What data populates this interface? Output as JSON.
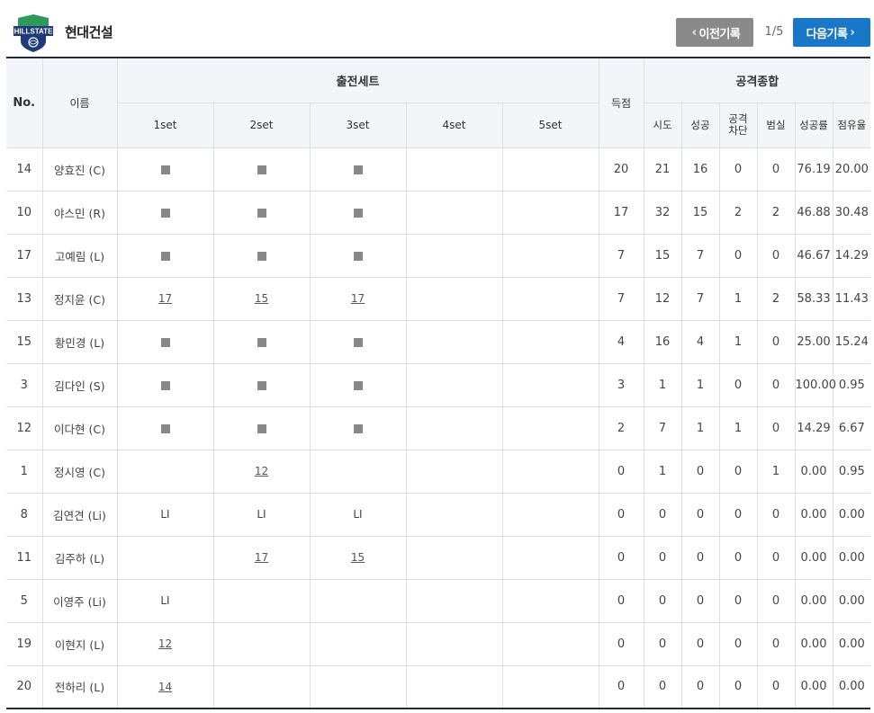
{
  "team": {
    "logo_text": "HILLSTATE",
    "name": "현대건설"
  },
  "nav": {
    "prev_label": "이전기록",
    "next_label": "다음기록",
    "page_indicator": "1/5"
  },
  "table": {
    "headers": {
      "no": "No.",
      "name": "이름",
      "sets_group": "출전세트",
      "sets": [
        "1set",
        "2set",
        "3set",
        "4set",
        "5set"
      ],
      "points": "득점",
      "attack_group": "공격종합",
      "attack": [
        "시도",
        "성공",
        "공격\n차단",
        "범실",
        "성공률",
        "점유율"
      ]
    },
    "rows": [
      {
        "no": "14",
        "name": "양효진 (C)",
        "sets": [
          "sq",
          "sq",
          "sq",
          "",
          ""
        ],
        "points": "20",
        "attempt": "21",
        "success": "16",
        "blocked": "0",
        "error": "0",
        "rate": "76.19",
        "share": "20.00"
      },
      {
        "no": "10",
        "name": "야스민 (R)",
        "sets": [
          "sq",
          "sq",
          "sq",
          "",
          ""
        ],
        "points": "17",
        "attempt": "32",
        "success": "15",
        "blocked": "2",
        "error": "2",
        "rate": "46.88",
        "share": "30.48"
      },
      {
        "no": "17",
        "name": "고예림 (L)",
        "sets": [
          "sq",
          "sq",
          "sq",
          "",
          ""
        ],
        "points": "7",
        "attempt": "15",
        "success": "7",
        "blocked": "0",
        "error": "0",
        "rate": "46.67",
        "share": "14.29"
      },
      {
        "no": "13",
        "name": "정지윤 (C)",
        "sets": [
          "17",
          "15",
          "17",
          "",
          ""
        ],
        "points": "7",
        "attempt": "12",
        "success": "7",
        "blocked": "1",
        "error": "2",
        "rate": "58.33",
        "share": "11.43"
      },
      {
        "no": "15",
        "name": "황민경 (L)",
        "sets": [
          "sq",
          "sq",
          "sq",
          "",
          ""
        ],
        "points": "4",
        "attempt": "16",
        "success": "4",
        "blocked": "1",
        "error": "0",
        "rate": "25.00",
        "share": "15.24"
      },
      {
        "no": "3",
        "name": "김다인 (S)",
        "sets": [
          "sq",
          "sq",
          "sq",
          "",
          ""
        ],
        "points": "3",
        "attempt": "1",
        "success": "1",
        "blocked": "0",
        "error": "0",
        "rate": "100.00",
        "share": "0.95"
      },
      {
        "no": "12",
        "name": "이다현 (C)",
        "sets": [
          "sq",
          "sq",
          "sq",
          "",
          ""
        ],
        "points": "2",
        "attempt": "7",
        "success": "1",
        "blocked": "1",
        "error": "0",
        "rate": "14.29",
        "share": "6.67"
      },
      {
        "no": "1",
        "name": "정시영 (C)",
        "sets": [
          "",
          "12",
          "",
          "",
          ""
        ],
        "points": "0",
        "attempt": "1",
        "success": "0",
        "blocked": "0",
        "error": "1",
        "rate": "0.00",
        "share": "0.95"
      },
      {
        "no": "8",
        "name": "김연견 (Li)",
        "sets": [
          "LI",
          "LI",
          "LI",
          "",
          ""
        ],
        "points": "0",
        "attempt": "0",
        "success": "0",
        "blocked": "0",
        "error": "0",
        "rate": "0.00",
        "share": "0.00"
      },
      {
        "no": "11",
        "name": "김주하 (L)",
        "sets": [
          "",
          "17",
          "15",
          "",
          ""
        ],
        "points": "0",
        "attempt": "0",
        "success": "0",
        "blocked": "0",
        "error": "0",
        "rate": "0.00",
        "share": "0.00"
      },
      {
        "no": "5",
        "name": "이영주 (Li)",
        "sets": [
          "LI",
          "",
          "",
          "",
          ""
        ],
        "points": "0",
        "attempt": "0",
        "success": "0",
        "blocked": "0",
        "error": "0",
        "rate": "0.00",
        "share": "0.00"
      },
      {
        "no": "19",
        "name": "이현지 (L)",
        "sets": [
          "12",
          "",
          "",
          "",
          ""
        ],
        "points": "0",
        "attempt": "0",
        "success": "0",
        "blocked": "0",
        "error": "0",
        "rate": "0.00",
        "share": "0.00"
      },
      {
        "no": "20",
        "name": "전하리 (L)",
        "sets": [
          "14",
          "",
          "",
          "",
          ""
        ],
        "points": "0",
        "attempt": "0",
        "success": "0",
        "blocked": "0",
        "error": "0",
        "rate": "0.00",
        "share": "0.00"
      }
    ]
  },
  "colors": {
    "accent": "#1877c9",
    "prev_button": "#8a8a8a",
    "header_bg": "#f4f5f8",
    "border": "#dcdfe6",
    "rule": "#1f2a44",
    "logo_green": "#2e9a5a",
    "logo_navy": "#1d3a7a"
  }
}
